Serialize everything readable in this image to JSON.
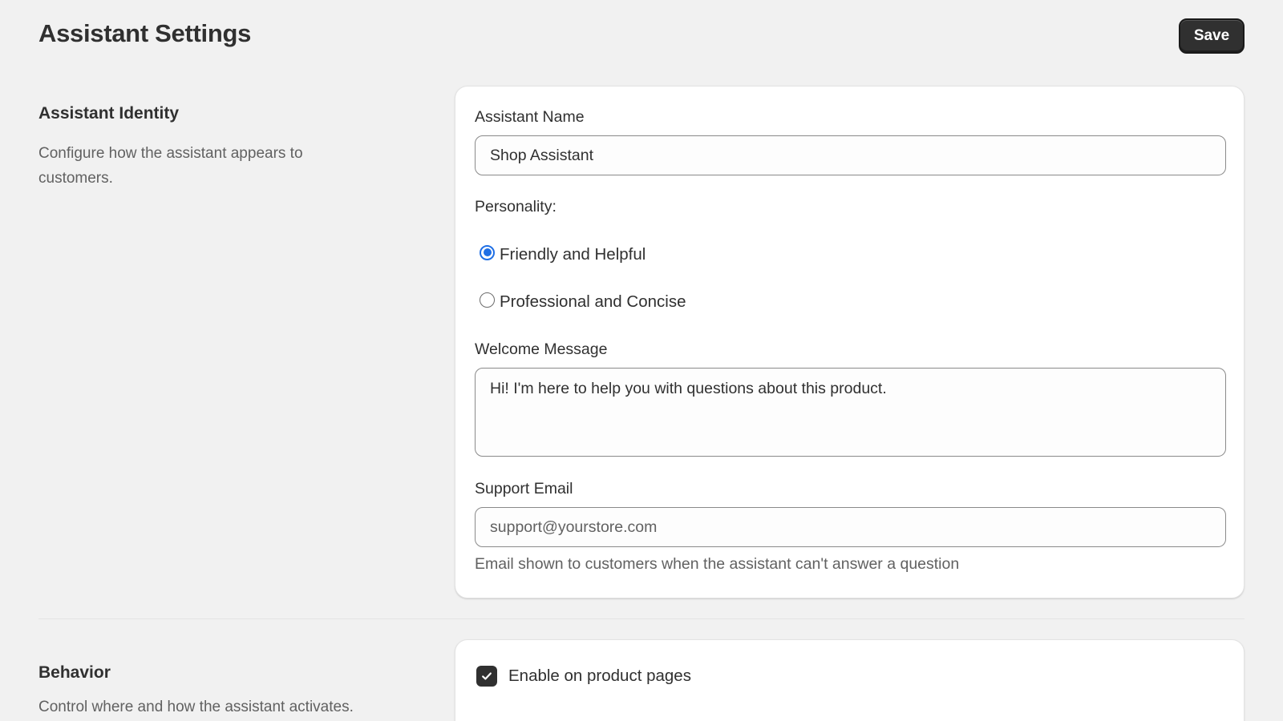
{
  "header": {
    "title": "Assistant Settings",
    "save_label": "Save"
  },
  "identity": {
    "title": "Assistant Identity",
    "description": "Configure how the assistant appears to customers.",
    "name_label": "Assistant Name",
    "name_value": "Shop Assistant",
    "personality_label": "Personality:",
    "personality_options": [
      {
        "label": "Friendly and Helpful",
        "selected": true
      },
      {
        "label": "Professional and Concise",
        "selected": false
      }
    ],
    "welcome_label": "Welcome Message",
    "welcome_value": "Hi! I'm here to help you with questions about this product.",
    "email_label": "Support Email",
    "email_value": "support@yourstore.com",
    "email_help": "Email shown to customers when the assistant can't answer a question"
  },
  "behavior": {
    "title": "Behavior",
    "description": "Control where and how the assistant activates.",
    "product_pages_label": "Enable on product pages",
    "product_pages_checked": true
  },
  "colors": {
    "background": "#f1f1f1",
    "primary_button": "#303030",
    "radio_accent": "#1f6fe5"
  }
}
